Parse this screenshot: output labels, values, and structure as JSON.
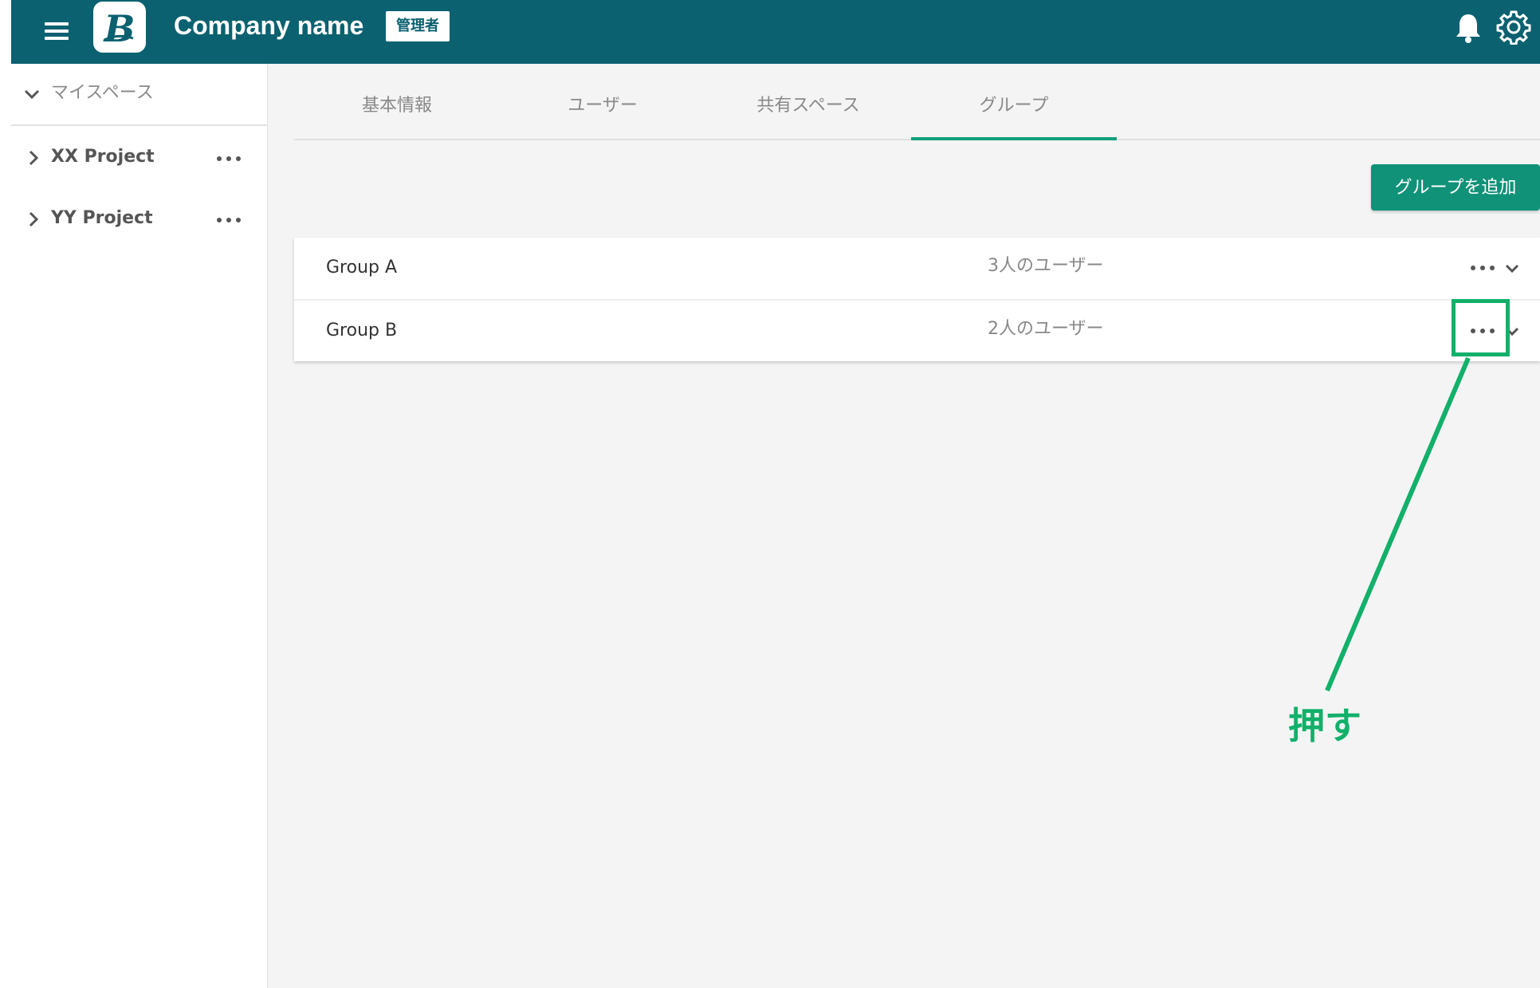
{
  "header": {
    "company_name": "Company name",
    "admin_badge": "管理者",
    "logo_letter": "B",
    "brand_color": "#0b6170",
    "icons": [
      "menu-icon",
      "bell-icon",
      "gear-icon"
    ]
  },
  "sidebar": {
    "myspace_label": "マイスペース",
    "projects": [
      {
        "label": "XX Project"
      },
      {
        "label": "YY Project"
      }
    ]
  },
  "tabs": [
    {
      "label": "基本情報",
      "active": false
    },
    {
      "label": "ユーザー",
      "active": false
    },
    {
      "label": "共有スペース",
      "active": false
    },
    {
      "label": "グループ",
      "active": true
    }
  ],
  "actions": {
    "add_group_label": "グループを追加",
    "accent_color": "#0f9278"
  },
  "groups": [
    {
      "name": "Group A",
      "count": "3人のユーザー"
    },
    {
      "name": "Group B",
      "count": "2人のユーザー"
    }
  ],
  "annotation": {
    "text": "押す",
    "color": "#12b06a"
  }
}
